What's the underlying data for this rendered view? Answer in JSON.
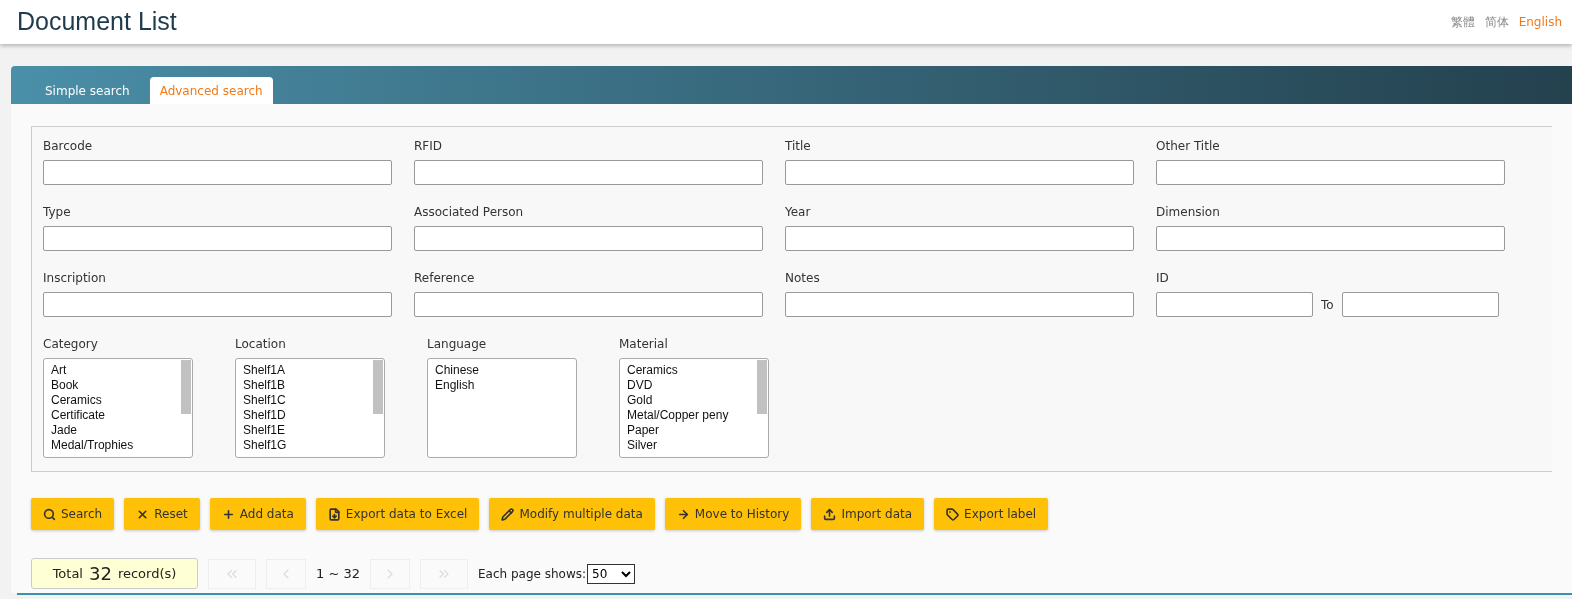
{
  "header": {
    "title": "Document List",
    "languages": [
      {
        "label": "繁體",
        "selected": false
      },
      {
        "label": "简体",
        "selected": false
      },
      {
        "label": "English",
        "selected": true
      }
    ]
  },
  "tabs": [
    {
      "label": "Simple search",
      "selected": false
    },
    {
      "label": "Advanced search",
      "selected": true
    }
  ],
  "fields": [
    {
      "label": "Barcode",
      "kind": "text"
    },
    {
      "label": "RFID",
      "kind": "text"
    },
    {
      "label": "Title",
      "kind": "text"
    },
    {
      "label": "Other Title",
      "kind": "text"
    },
    {
      "label": "Type",
      "kind": "text"
    },
    {
      "label": "Associated Person",
      "kind": "text"
    },
    {
      "label": "Year",
      "kind": "text"
    },
    {
      "label": "Dimension",
      "kind": "text"
    },
    {
      "label": "Inscription",
      "kind": "text"
    },
    {
      "label": "Reference",
      "kind": "text"
    },
    {
      "label": "Notes",
      "kind": "text"
    },
    {
      "label": "ID",
      "kind": "range",
      "separator": "To"
    }
  ],
  "lists": [
    {
      "label": "Category",
      "scrollbar": true,
      "options": [
        "Art",
        "Book",
        "Ceramics",
        "Certificate",
        "Jade",
        "Medal/Trophies"
      ]
    },
    {
      "label": "Location",
      "scrollbar": true,
      "options": [
        "Shelf1A",
        "Shelf1B",
        "Shelf1C",
        "Shelf1D",
        "Shelf1E",
        "Shelf1G"
      ]
    },
    {
      "label": "Language",
      "scrollbar": false,
      "options": [
        "Chinese",
        "English"
      ]
    },
    {
      "label": "Material",
      "scrollbar": true,
      "options": [
        "Ceramics",
        "DVD",
        "Gold",
        "Metal/Copper peny",
        "Paper",
        "Silver"
      ]
    }
  ],
  "buttons": [
    {
      "label": "Search",
      "kind": "search"
    },
    {
      "label": "Reset",
      "kind": "reset"
    },
    {
      "label": "Add data",
      "kind": "add"
    },
    {
      "label": "Export data to Excel",
      "kind": "excel"
    },
    {
      "label": "Modify multiple data",
      "kind": "modify"
    },
    {
      "label": "Move to History",
      "kind": "move"
    },
    {
      "label": "Import data",
      "kind": "import"
    },
    {
      "label": "Export label",
      "kind": "label"
    }
  ],
  "pagination": {
    "total_prefix": "Total",
    "total": "32",
    "total_suffix": "record(s)",
    "range": "1 ~ 32",
    "page_size_label": "Each page shows:",
    "page_size": "50"
  }
}
